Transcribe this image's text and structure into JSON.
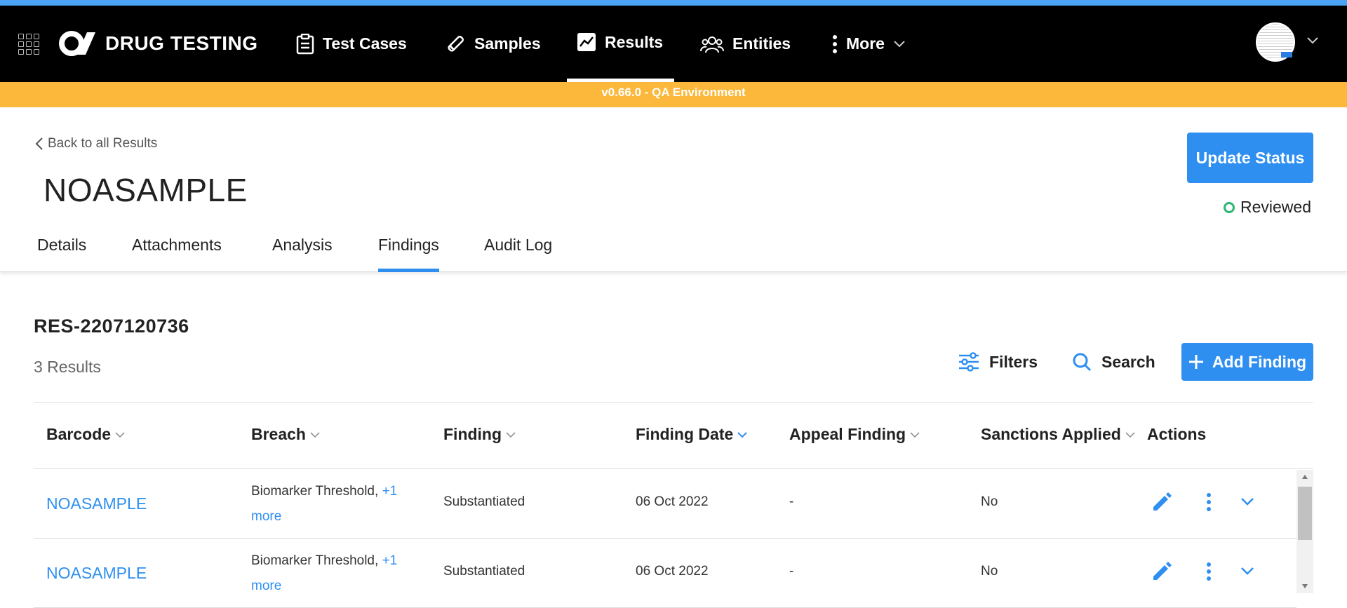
{
  "app": {
    "brand": "DRUG TESTING"
  },
  "nav": {
    "items": [
      {
        "label": "Test Cases",
        "icon": "clipboard-icon"
      },
      {
        "label": "Samples",
        "icon": "test-tube-icon"
      },
      {
        "label": "Results",
        "icon": "chart-icon",
        "active": true
      },
      {
        "label": "Entities",
        "icon": "people-icon"
      }
    ],
    "more_label": "More"
  },
  "env_banner": "v0.66.0 - QA Environment",
  "header": {
    "back_label": "Back to all Results",
    "title": "NOASAMPLE",
    "update_button": "Update Status",
    "status": "Reviewed"
  },
  "tabs": [
    "Details",
    "Attachments",
    "Analysis",
    "Findings",
    "Audit Log"
  ],
  "active_tab": "Findings",
  "results": {
    "id": "RES-2207120736",
    "count_label": "3 Results",
    "filters_label": "Filters",
    "search_label": "Search",
    "add_label": "Add Finding"
  },
  "table": {
    "columns": [
      "Barcode",
      "Breach",
      "Finding",
      "Finding Date",
      "Appeal Finding",
      "Sanctions Applied",
      "Actions"
    ],
    "rows": [
      {
        "barcode": "NOASAMPLE",
        "breach": "Biomarker Threshold,",
        "breach_more": "+1 more",
        "finding": "Substantiated",
        "date": "06 Oct 2022",
        "appeal": "-",
        "sanctions": "No"
      },
      {
        "barcode": "NOASAMPLE",
        "breach": "Biomarker Threshold,",
        "breach_more": "+1 more",
        "finding": "Substantiated",
        "date": "06 Oct 2022",
        "appeal": "-",
        "sanctions": "No"
      }
    ]
  },
  "colors": {
    "accent": "#2e8ff0",
    "env": "#fbb83b",
    "nav_bg": "#000000",
    "status_ok": "#2bb673"
  }
}
